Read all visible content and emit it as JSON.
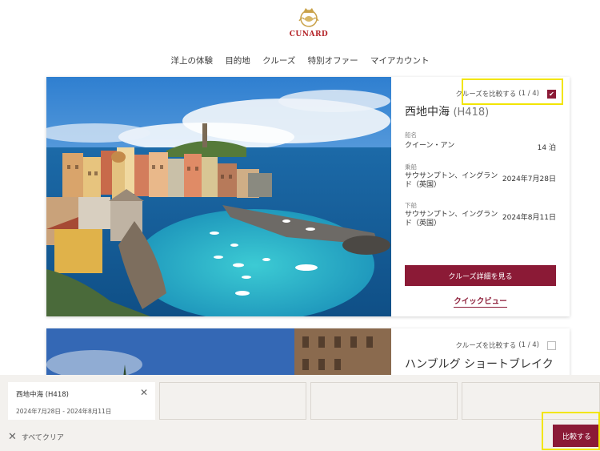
{
  "brand": {
    "logo_text": "CUNARD",
    "accent": "#8b1a36",
    "logo_red": "#b5262b"
  },
  "nav": {
    "items": [
      "洋上の体験",
      "目的地",
      "クルーズ",
      "特別オファー",
      "マイアカウント"
    ]
  },
  "cards": [
    {
      "compare_label": "クルーズを比較する",
      "compare_count": "(1 / 4)",
      "checked": true,
      "title": "西地中海",
      "code": "(H418)",
      "ship_label": "船名",
      "ship_value": "クイーン・アン",
      "nights": "14 泊",
      "embark_label": "乗船",
      "embark_port": "サウサンプトン、イングランド（英国）",
      "embark_date": "2024年7月28日",
      "disembark_label": "下船",
      "disembark_port": "サウサンプトン、イングランド（英国）",
      "disembark_date": "2024年8月11日",
      "detail_button": "クルーズ詳細を見る",
      "quick_view": "クイックビュー"
    },
    {
      "compare_label": "クルーズを比較する",
      "compare_count": "(1 / 4)",
      "checked": false,
      "title": "ハンブルグ ショートブレイク"
    }
  ],
  "compare_bar": {
    "slot1_title": "西地中海 (H418)",
    "slot1_dates": "2024年7月28日 - 2024年8月11日",
    "clear_all": "すべてクリア",
    "compare_button": "比較する"
  }
}
